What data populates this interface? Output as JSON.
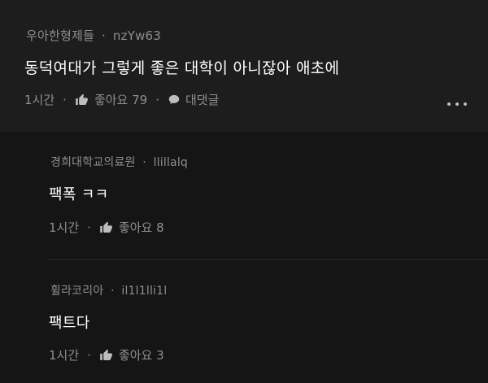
{
  "main_comment": {
    "author": "우아한형제들",
    "user_id": "nzYw63",
    "separator": "·",
    "body": "동덕여대가 그렇게 좋은 대학이 아니잖아 애초에",
    "time": "1시간",
    "like_label": "좋아요 79",
    "reply_label": "대댓글",
    "icons": {
      "like": "thumbs-up-icon",
      "reply": "speech-bubble-icon",
      "more": "more-dots-icon"
    }
  },
  "replies": [
    {
      "author": "경희대학교의료원",
      "user_id": "llillalq",
      "body": "팩폭 ㅋㅋ",
      "time": "1시간",
      "like_label": "좋아요 8"
    },
    {
      "author": "휠라코리아",
      "user_id": "il1l1lli1l",
      "body": "팩트다",
      "time": "1시간",
      "like_label": "좋아요 3"
    }
  ],
  "colors": {
    "background": "#151515",
    "main_comment_bg": "#1d1d1d",
    "primary_text": "#ffffff",
    "secondary_text": "#8e8e8e"
  }
}
